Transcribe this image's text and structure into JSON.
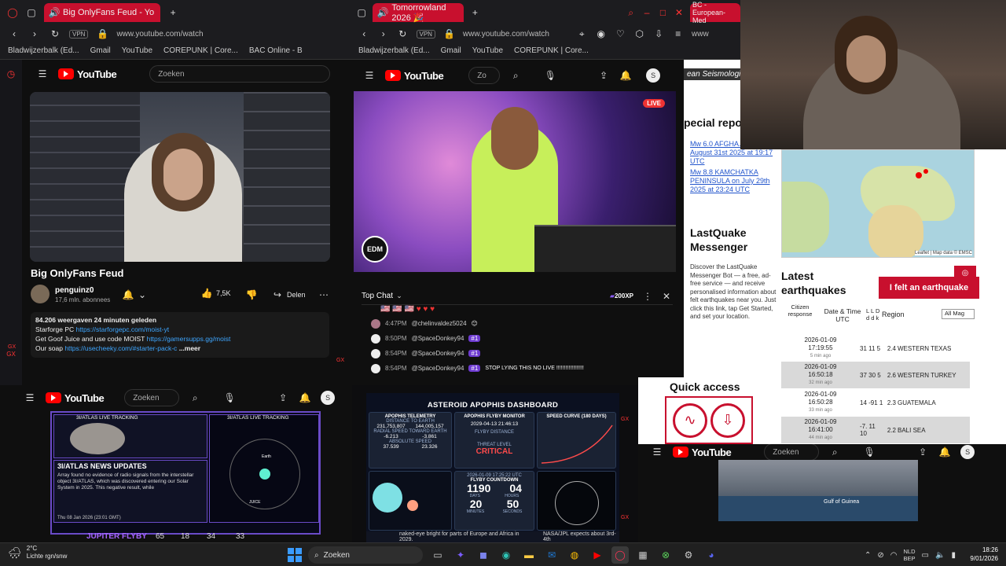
{
  "left_window": {
    "tab_title": "Big OnlyFans Feud - Yo",
    "url": "www.youtube.com/watch",
    "vpn": "VPN",
    "bookmarks": [
      "Bladwijzerbalk (Ed...",
      "Gmail",
      "YouTube",
      "COREPUNK | Core...",
      "BAC Online - B"
    ],
    "search_placeholder": "Zoeken",
    "video_title": "Big OnlyFans Feud",
    "channel": "penguinz0",
    "subscribers": "17,6 mln. abonnees",
    "likes": "7,5K",
    "share": "Delen",
    "desc_stats": "84.206 weergaven  24 minuten geleden",
    "desc_l1a": "Starforge PC ",
    "desc_l1b": "https://starforgepc.com/moist-yt",
    "desc_l2a": "Get Goof Juice and use code MOIST ",
    "desc_l2b": "https://gamersupps.gg/moist",
    "desc_l3a": "Our soap ",
    "desc_l3b": "https://usecheeky.com/#starter-pack-c",
    "desc_more": "...meer"
  },
  "mid_window": {
    "tab_title": "Tomorrowland 2026 🎉",
    "url": "www.youtube.com/watch",
    "vpn": "VPN",
    "bookmarks": [
      "Bladwijzerbalk (Ed...",
      "Gmail",
      "YouTube",
      "COREPUNK | Core..."
    ],
    "search_placeholder": "Zo",
    "avatar_letter": "S",
    "live_badge": "LIVE",
    "edm_logo": "EDM",
    "chat_title": "Top Chat",
    "points": "200XP",
    "chat": [
      {
        "time": "4:47PM",
        "user": "@chelinvaldez5024",
        "badge": "",
        "msg": ""
      },
      {
        "time": "8:50PM",
        "user": "@SpaceDonkey94",
        "badge": "#1",
        "msg": ""
      },
      {
        "time": "8:54PM",
        "user": "@SpaceDonkey94",
        "badge": "#1",
        "msg": ""
      },
      {
        "time": "8:54PM",
        "user": "@SpaceDonkey94",
        "badge": "#1",
        "msg": "STOP LYING THIS NO LIVE !!!!!!!!!!!!!!!!!!"
      }
    ]
  },
  "right_window": {
    "tab_title": "BC - European-Med",
    "url": "www",
    "org": "ean Seismological",
    "special": "pecial repo",
    "link1": "Mw 6.0 AFGHA... on August 31st 2025 at 19:17 UTC",
    "link2": "Mw 8.8 KAMCHATKA PENINSULA on July 29th 2025 at 23:24 UTC",
    "lq_title": "LastQuake Messenger",
    "lq_text": "Discover the LastQuake Messenger Bot — a free, ad-free service — and receive personalised information about felt earthquakes near you. Just click this link, tap Get Started, and set your location.",
    "map_attr": "Leaflet | Map data © EMSC",
    "latest": "Latest earthquakes",
    "felt_button": "I felt an earthquake",
    "col_citizen": "Citizen response",
    "col_date": "Date & Time UTC",
    "col_lld": "L L D d d k",
    "col_region": "Region",
    "filter": "All Mag",
    "quakes": [
      {
        "date": "2026-01-09",
        "time": "17:19:55",
        "ago": "5 min ago",
        "vals": "31  11  5",
        "mag": "2.4",
        "region": "WESTERN TEXAS"
      },
      {
        "date": "2026-01-09",
        "time": "16:50:18",
        "ago": "32 min ago",
        "vals": "37  30  5",
        "mag": "2.6",
        "region": "WESTERN TURKEY"
      },
      {
        "date": "2026-01-09",
        "time": "16:50:28",
        "ago": "33 min ago",
        "vals": "14  -91  1",
        "mag": "2.3",
        "region": "GUATEMALA"
      },
      {
        "date": "2026-01-09",
        "time": "16:41:00",
        "ago": "44 min ago",
        "vals": "-7.  11  10",
        "mag": "2.2",
        "region": "BALI SEA"
      }
    ],
    "quick": "Quick access"
  },
  "bottom_left": {
    "search_placeholder": "Zoeken",
    "avatar_letter": "S",
    "tracking1": "3I/ATLAS LIVE TRACKING",
    "tracking2": "3I/ATLAS LIVE TRACKING",
    "news_title": "3I/ATLAS NEWS UPDATES",
    "news_text": "Array found no evidence of radio signals from the interstellar object 3I/ATLAS, which was discovered entering our Solar System in 2025. This negative result, while",
    "date": "Thu 08 Jan 2026 (23:01 GMT)",
    "jupiter": "JUPITER FLYBY",
    "counts": [
      "65",
      "18",
      "34",
      "33"
    ],
    "earth_label": "Earth",
    "juice_label": "JUICE"
  },
  "bottom_mid": {
    "dash_title": "ASTEROID APOPHIS DASHBOARD",
    "telemetry": "APOPHIS TELEMETRY",
    "dist_label": "DISTANCE TO EARTH",
    "dist_km": "231,753,807",
    "dist_mi": "144,005,157",
    "radial_label": "RADIAL SPEED TOWARD EARTH",
    "radial": "-6.213",
    "radial2": "-3.861",
    "abs_label": "ABSOLUTE SPEED",
    "abs": "37.539",
    "abs2": "23.326",
    "flyby_title": "APOPHIS FLYBY MONITOR",
    "flyby_date": "2029-04-13   21:46:13",
    "flyby_dist": "FLYBY DISTANCE",
    "threat": "THREAT LEVEL",
    "critical": "CRITICAL",
    "speed_curve": "SPEED CURVE (180 DAYS)",
    "countdown_date": "2026-01-09 17:25:22 UTC",
    "countdown_title": "FLYBY COUNTDOWN",
    "cd_days": "1190",
    "cd_hours": "04",
    "cd_min": "20",
    "cd_sec": "50",
    "cd_l1": "DAYS",
    "cd_l2": "HOURS",
    "cd_l3": "MINUTES",
    "cd_l4": "SECONDS",
    "ticker": "naked-eye bright for parts of Europe and Africa in 2029.",
    "ticker2": "NASA/JPL expects about 3rd-4th"
  },
  "bottom_right": {
    "search_placeholder": "Zoeken",
    "avatar_letter": "S",
    "map_label": "Gulf of Guinea"
  },
  "taskbar": {
    "temp": "2°C",
    "weather": "Lichte rgn/snw",
    "search": "Zoeken",
    "lang1": "NLD",
    "lang2": "BEP",
    "time": "18:26",
    "date": "9/01/2026"
  },
  "colors": {
    "youtube_red": "#ff0000",
    "opera_red": "#e3001b",
    "emsc_red": "#c8102e",
    "critical": "#ff4b4b"
  }
}
